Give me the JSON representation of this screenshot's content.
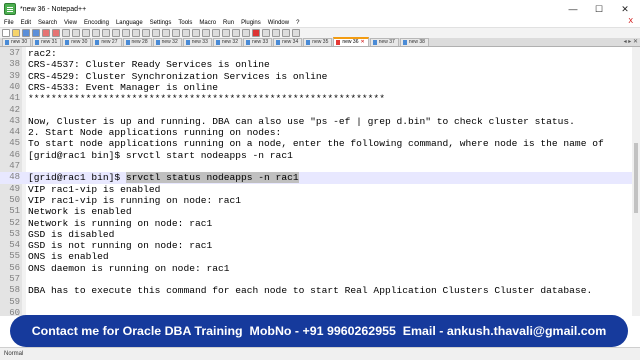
{
  "window": {
    "title": "*new 36 - Notepad++",
    "minimize": "—",
    "maximize": "☐",
    "close": "✕"
  },
  "menu": {
    "items": [
      "File",
      "Edit",
      "Search",
      "View",
      "Encoding",
      "Language",
      "Settings",
      "Tools",
      "Macro",
      "Run",
      "Plugins",
      "Window",
      "?"
    ],
    "close_doc": "X"
  },
  "tabs": [
    {
      "label": "new 30"
    },
    {
      "label": "new 31"
    },
    {
      "label": "new 30"
    },
    {
      "label": "new 27"
    },
    {
      "label": "new 28"
    },
    {
      "label": "new 32"
    },
    {
      "label": "new 33"
    },
    {
      "label": "new 32"
    },
    {
      "label": "new 33"
    },
    {
      "label": "new 34"
    },
    {
      "label": "new 35"
    },
    {
      "label": "new 36",
      "active": true
    },
    {
      "label": "new 37"
    },
    {
      "label": "new 38"
    }
  ],
  "editor": {
    "lines": [
      {
        "num": "37",
        "text": "rac2:"
      },
      {
        "num": "38",
        "text": "CRS-4537: Cluster Ready Services is online"
      },
      {
        "num": "39",
        "text": "CRS-4529: Cluster Synchronization Services is online"
      },
      {
        "num": "40",
        "text": "CRS-4533: Event Manager is online"
      },
      {
        "num": "41",
        "text": "**************************************************************"
      },
      {
        "num": "42",
        "text": ""
      },
      {
        "num": "43",
        "text": "Now, Cluster is up and running. DBA can also use \"ps -ef | grep d.bin\" to check cluster status."
      },
      {
        "num": "44",
        "text": "2. Start Node applications running on nodes:"
      },
      {
        "num": "45",
        "text": "To start node applications running on a node, enter the following command, where node is the name of"
      },
      {
        "num": "46",
        "text": "[grid@rac1 bin]$ srvctl start nodeapps -n rac1"
      },
      {
        "num": "47",
        "text": ""
      },
      {
        "num": "48",
        "text": "[grid@rac1 bin]$ ",
        "selected": "srvctl status nodeapps -n rac1"
      },
      {
        "num": "49",
        "text": "VIP rac1-vip is enabled"
      },
      {
        "num": "50",
        "text": "VIP rac1-vip is running on node: rac1"
      },
      {
        "num": "51",
        "text": "Network is enabled"
      },
      {
        "num": "52",
        "text": "Network is running on node: rac1"
      },
      {
        "num": "53",
        "text": "GSD is disabled"
      },
      {
        "num": "54",
        "text": "GSD is not running on node: rac1"
      },
      {
        "num": "55",
        "text": "ONS is enabled"
      },
      {
        "num": "56",
        "text": "ONS daemon is running on node: rac1"
      },
      {
        "num": "57",
        "text": ""
      },
      {
        "num": "58",
        "text": "DBA has to execute this command for each node to start Real Application Clusters Cluster database."
      },
      {
        "num": "59",
        "text": ""
      },
      {
        "num": "60",
        "text": ""
      }
    ]
  },
  "banner": {
    "text": "Contact me for Oracle DBA Training  MobNo - +91 9960262955  Email - ankush.thavali@gmail.com"
  },
  "statusbar": {
    "left": "Normal"
  },
  "colors": {
    "banner_bg": "#163a9c",
    "active_tab_accent": "#f39c12",
    "selection": "#c0c0c0"
  }
}
